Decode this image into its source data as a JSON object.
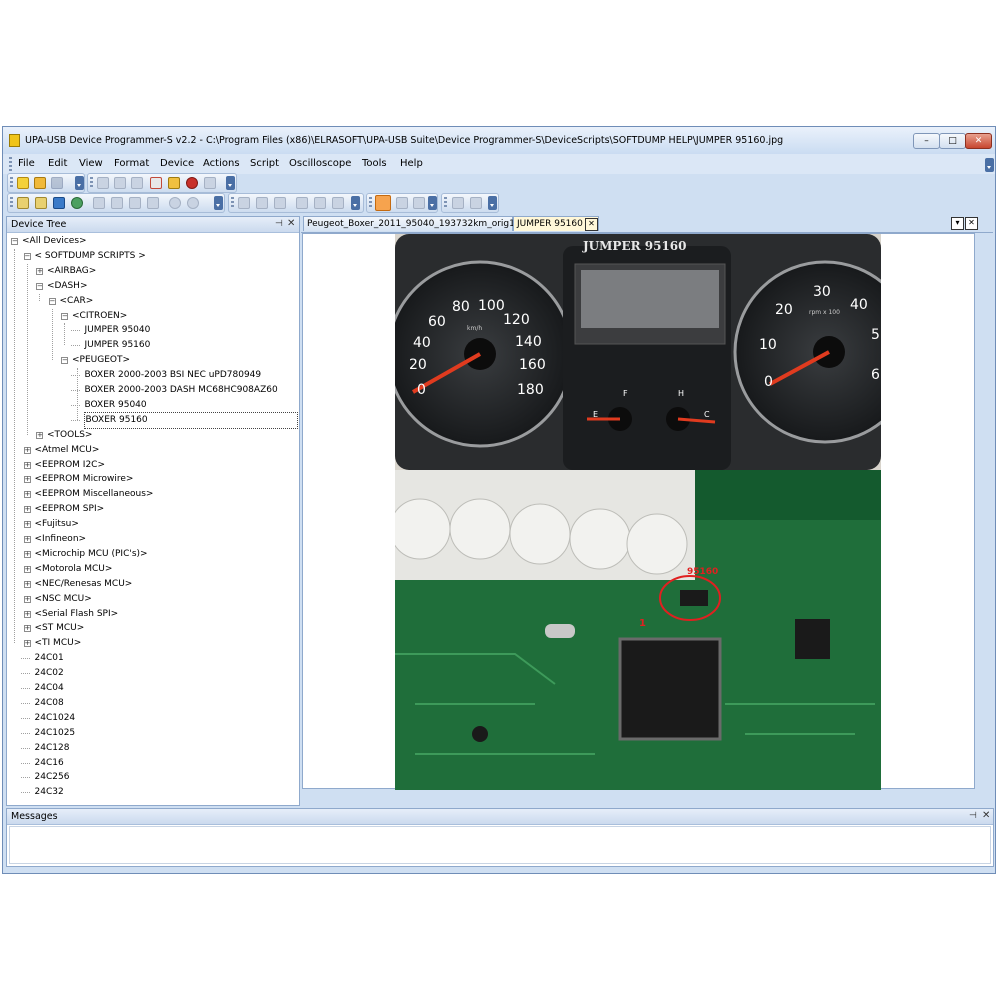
{
  "window": {
    "title": "UPA-USB Device Programmer-S v2.2 - C:\\Program Files (x86)\\ELRASOFT\\UPA-USB Suite\\Device Programmer-S\\DeviceScripts\\SOFTDUMP HELP\\JUMPER 95160.jpg",
    "controls": {
      "minimize": "–",
      "maximize": "□",
      "close": "✕"
    }
  },
  "menu": [
    "File",
    "Edit",
    "View",
    "Format",
    "Device",
    "Actions",
    "Script",
    "Oscilloscope",
    "Tools",
    "Help"
  ],
  "device_tree": {
    "title": "Device Tree",
    "pin": "⊣",
    "close": "✕",
    "items": [
      {
        "label": "<All Devices>",
        "expander": "−"
      },
      {
        "label": "< SOFTDUMP SCRIPTS >",
        "expander": "−"
      },
      {
        "label": "<AIRBAG>",
        "expander": "+"
      },
      {
        "label": "<DASH>",
        "expander": "−"
      },
      {
        "label": "<CAR>",
        "expander": "−"
      },
      {
        "label": "<CITROEN>",
        "expander": "−"
      },
      {
        "label": "JUMPER 95040",
        "expander": ""
      },
      {
        "label": "JUMPER 95160",
        "expander": ""
      },
      {
        "label": "<PEUGEOT>",
        "expander": "−"
      },
      {
        "label": "BOXER 2000-2003 BSI NEC uPD780949",
        "expander": ""
      },
      {
        "label": "BOXER 2000-2003 DASH MC68HC908AZ60",
        "expander": ""
      },
      {
        "label": "BOXER 95040",
        "expander": ""
      },
      {
        "label": "BOXER 95160",
        "expander": ""
      },
      {
        "label": "<TOOLS>",
        "expander": "+"
      },
      {
        "label": "<Atmel MCU>",
        "expander": "+"
      },
      {
        "label": "<EEPROM I2C>",
        "expander": "+"
      },
      {
        "label": "<EEPROM Microwire>",
        "expander": "+"
      },
      {
        "label": "<EEPROM Miscellaneous>",
        "expander": "+"
      },
      {
        "label": "<EEPROM SPI>",
        "expander": "+"
      },
      {
        "label": "<Fujitsu>",
        "expander": "+"
      },
      {
        "label": "<Infineon>",
        "expander": "+"
      },
      {
        "label": "<Microchip MCU (PIC's)>",
        "expander": "+"
      },
      {
        "label": "<Motorola MCU>",
        "expander": "+"
      },
      {
        "label": "<NEC/Renesas MCU>",
        "expander": "+"
      },
      {
        "label": "<NSC MCU>",
        "expander": "+"
      },
      {
        "label": "<Serial Flash SPI>",
        "expander": "+"
      },
      {
        "label": "<ST MCU>",
        "expander": "+"
      },
      {
        "label": "<TI MCU>",
        "expander": "+"
      },
      {
        "label": "24C01",
        "expander": ""
      },
      {
        "label": "24C02",
        "expander": ""
      },
      {
        "label": "24C04",
        "expander": ""
      },
      {
        "label": "24C08",
        "expander": ""
      },
      {
        "label": "24C1024",
        "expander": ""
      },
      {
        "label": "24C1025",
        "expander": ""
      },
      {
        "label": "24C128",
        "expander": ""
      },
      {
        "label": "24C16",
        "expander": ""
      },
      {
        "label": "24C256",
        "expander": ""
      },
      {
        "label": "24C32",
        "expander": ""
      }
    ]
  },
  "tabs": [
    {
      "label": "Peugeot_Boxer_2011_95040_193732km_orig1.bin",
      "active": false
    },
    {
      "label": "JUMPER 95160",
      "active": true
    }
  ],
  "tab_close": "✕",
  "tab_menu": "▾",
  "document": {
    "dashboard": {
      "brand": "JUMPER 95160",
      "speed_labels": [
        "0",
        "20",
        "40",
        "60",
        "80",
        "100",
        "120",
        "140",
        "160",
        "180"
      ],
      "speed_unit": "km/h",
      "rpm_labels": [
        "0",
        "10",
        "20",
        "30",
        "40",
        "5",
        "6"
      ],
      "rpm_unit": "rpm x 100",
      "fuel_labels": [
        "E",
        "F"
      ],
      "temp_labels": [
        "H",
        "C"
      ]
    },
    "pcb": {
      "chip_label": "95160",
      "pin_mark": "1"
    }
  },
  "messages": {
    "title": "Messages",
    "pin": "⊣",
    "close": "✕"
  },
  "colors": {
    "window_frame": "#cfdff2",
    "needle": "#e03b1f",
    "pcb_green": "#1f6e3a",
    "marker_red": "#e02020"
  }
}
